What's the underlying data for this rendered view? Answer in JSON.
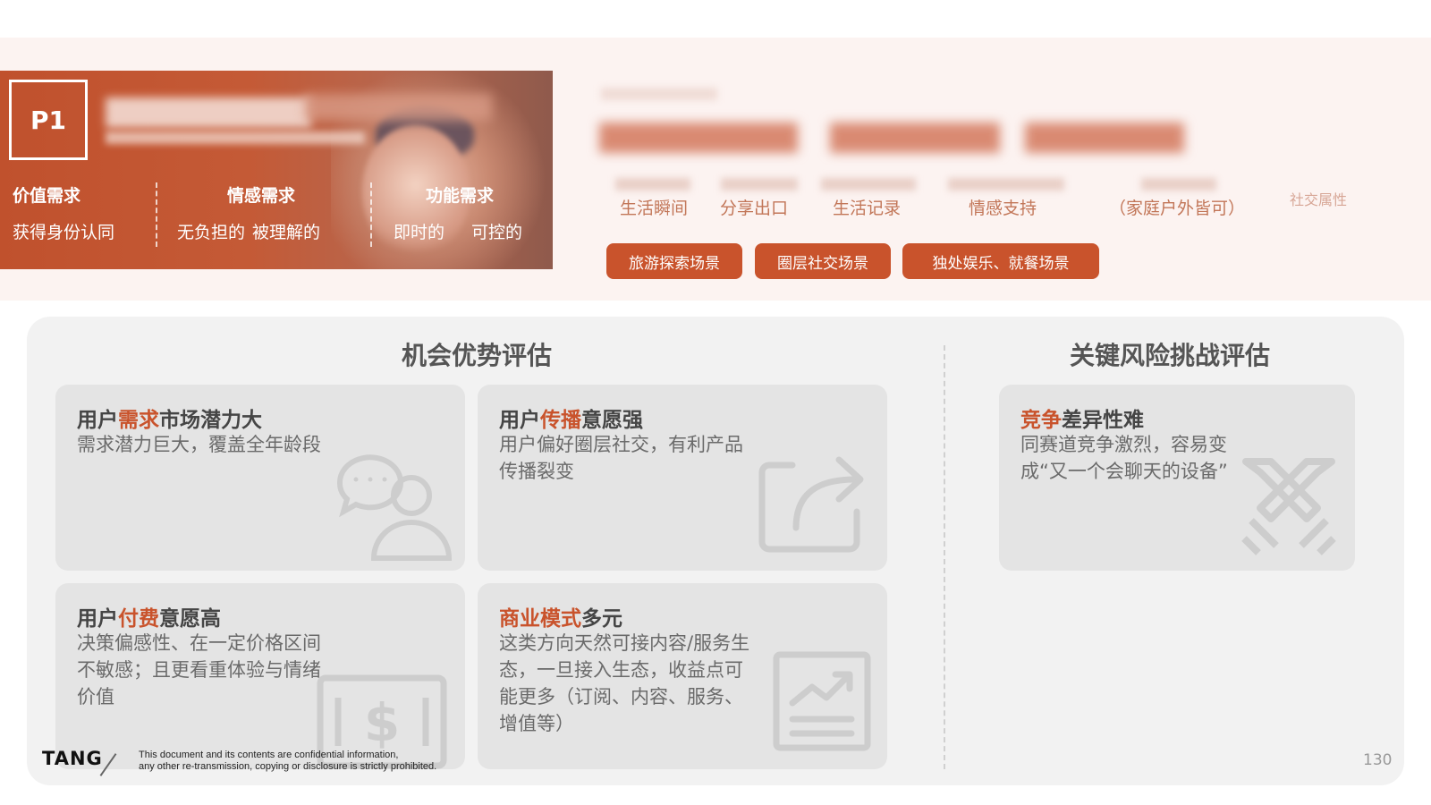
{
  "persona": {
    "badge": "P1",
    "needs": [
      {
        "title": "价值需求",
        "values": [
          "获得身份认同"
        ]
      },
      {
        "title": "情感需求",
        "values": [
          "无负担的",
          "被理解的"
        ]
      },
      {
        "title": "功能需求",
        "values": [
          "即时的",
          "可控的"
        ]
      }
    ]
  },
  "scenarios": {
    "labels": [
      "生活瞬间",
      "分享出口",
      "生活记录",
      "情感支持",
      "（家庭户外皆可）"
    ],
    "extra_label": "社交属性",
    "pills": [
      "旅游探索场景",
      "圈层社交场景",
      "独处娱乐、就餐场景"
    ]
  },
  "opportunity": {
    "title": "机会优势评估",
    "cards": [
      {
        "pre": "用户",
        "hl": "需求",
        "post": "市场潜力大",
        "body": "需求潜力巨大，覆盖全年龄段",
        "icon": "user-chat-icon"
      },
      {
        "pre": "用户",
        "hl": "传播",
        "post": "意愿强",
        "body": "用户偏好圈层社交，有利产品传播裂变",
        "icon": "share-icon"
      },
      {
        "pre": "用户",
        "hl": "付费",
        "post": "意愿高",
        "body": "决策偏感性、在一定价格区间不敏感；且更看重体验与情绪价值",
        "icon": "dollar-icon"
      },
      {
        "pre": "",
        "hl": "商业模式",
        "post": "多元",
        "body": "这类方向天然可接内容/服务生态，一旦接入生态，收益点可能更多（订阅、内容、服务、增值等）",
        "icon": "chart-board-icon"
      }
    ]
  },
  "risk": {
    "title": "关键风险挑战评估",
    "cards": [
      {
        "pre": "",
        "hl": "竞争",
        "post": "差异性难",
        "body": "同赛道竞争激烈，容易变成“又一个会聊天的设备”",
        "icon": "crossed-swords-icon"
      }
    ]
  },
  "footer": {
    "brand": "TANG",
    "note_line1": "This document and its contents are confidential information,",
    "note_line2": "any other re-transmission, copying or disclosure is strictly prohibited.",
    "page": "130"
  },
  "colors": {
    "accent": "#c9532c",
    "panel": "#f2f2f2",
    "card": "#e4e4e4",
    "band": "#fcf3f1"
  }
}
